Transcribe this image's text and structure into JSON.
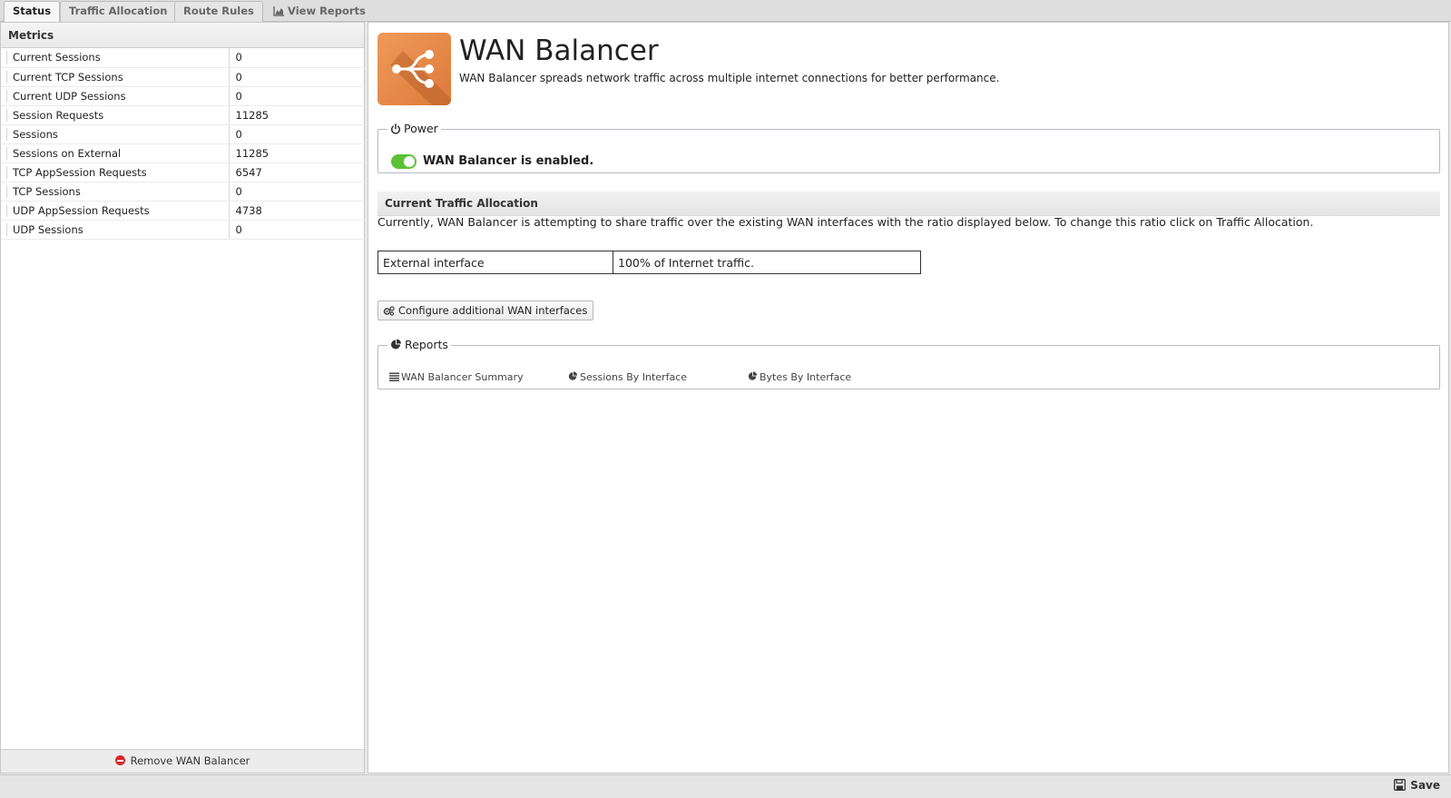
{
  "tabs": [
    {
      "label": "Status",
      "active": true
    },
    {
      "label": "Traffic Allocation",
      "active": false
    },
    {
      "label": "Route Rules",
      "active": false
    },
    {
      "label": "View Reports",
      "active": false,
      "icon": "area-chart-icon"
    }
  ],
  "metrics": {
    "header": "Metrics",
    "rows": [
      {
        "name": "Current Sessions",
        "value": "0"
      },
      {
        "name": "Current TCP Sessions",
        "value": "0"
      },
      {
        "name": "Current UDP Sessions",
        "value": "0"
      },
      {
        "name": "Session Requests",
        "value": "11285"
      },
      {
        "name": "Sessions",
        "value": "0"
      },
      {
        "name": "Sessions on External",
        "value": "11285"
      },
      {
        "name": "TCP AppSession Requests",
        "value": "6547"
      },
      {
        "name": "TCP Sessions",
        "value": "0"
      },
      {
        "name": "UDP AppSession Requests",
        "value": "4738"
      },
      {
        "name": "UDP Sessions",
        "value": "0"
      }
    ],
    "remove_label": "Remove WAN Balancer"
  },
  "app": {
    "title": "WAN Balancer",
    "description": "WAN Balancer spreads network traffic across multiple internet connections for better performance.",
    "icon": "wan-balancer-icon",
    "icon_color": "#e88a4a"
  },
  "power": {
    "legend": "Power",
    "status_text": "WAN Balancer is enabled.",
    "enabled": true,
    "toggle_color": "#5bc236"
  },
  "traffic": {
    "header": "Current Traffic Allocation",
    "description": "Currently, WAN Balancer is attempting to share traffic over the existing WAN interfaces with the ratio displayed below. To change this ratio click on Traffic Allocation.",
    "rows": [
      {
        "interface": "External interface",
        "share": "100% of Internet traffic."
      }
    ],
    "configure_label": "Configure additional WAN interfaces"
  },
  "reports": {
    "legend": "Reports",
    "links": [
      {
        "label": "WAN Balancer Summary",
        "icon": "list-icon"
      },
      {
        "label": "Sessions By Interface",
        "icon": "pie-chart-icon"
      },
      {
        "label": "Bytes By Interface",
        "icon": "pie-chart-icon"
      }
    ]
  },
  "footer": {
    "save_label": "Save"
  }
}
